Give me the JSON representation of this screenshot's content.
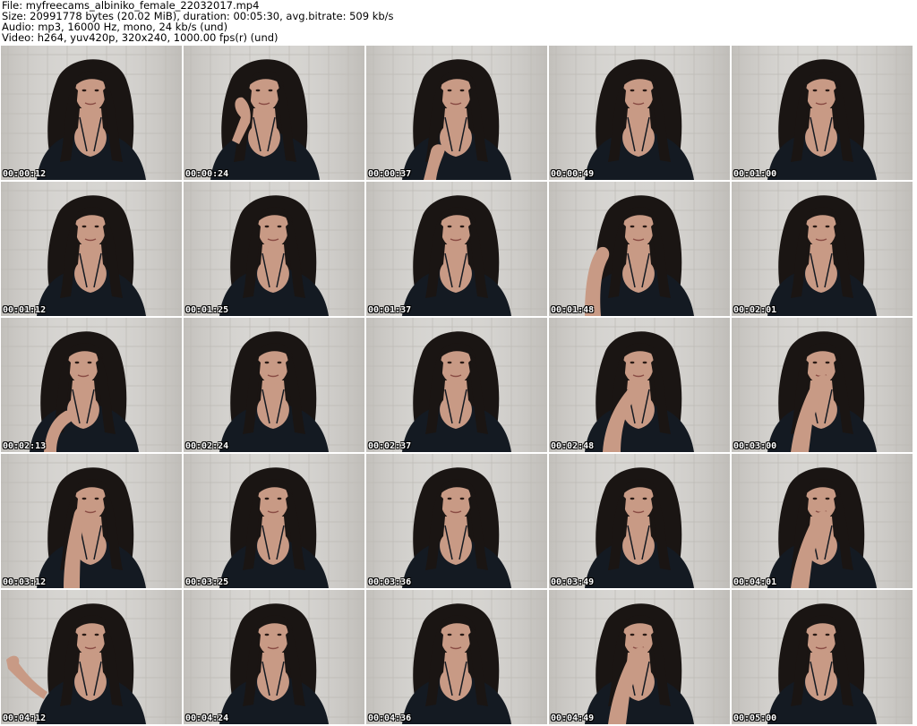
{
  "header": {
    "file": "File: myfreecams_albiniko_female_22032017.mp4",
    "size": "Size: 20991778 bytes (20.02 MiB), duration: 00:05:30, avg.bitrate: 509 kb/s",
    "audio": "Audio: mp3, 16000 Hz, mono, 24 kb/s (und)",
    "video": "Video: h264, yuv420p, 320x240, 1000.00 fps(r) (und)"
  },
  "colors": {
    "wall": "#cfcdc9",
    "tile_line": "#bdbab5",
    "hair": "#1a1513",
    "skin": "#c89a85",
    "top": "#141a22"
  },
  "thumbnails": [
    {
      "time": "00:00:12",
      "pose": "neutral"
    },
    {
      "time": "00:00:24",
      "pose": "hand-neck"
    },
    {
      "time": "00:00:37",
      "pose": "hand-low"
    },
    {
      "time": "00:00:49",
      "pose": "neutral"
    },
    {
      "time": "00:01:00",
      "pose": "neutral"
    },
    {
      "time": "00:01:12",
      "pose": "neutral"
    },
    {
      "time": "00:01:25",
      "pose": "neutral"
    },
    {
      "time": "00:01:37",
      "pose": "neutral"
    },
    {
      "time": "00:01:48",
      "pose": "hand-hair"
    },
    {
      "time": "00:02:01",
      "pose": "neutral"
    },
    {
      "time": "00:02:13",
      "pose": "hand-chest"
    },
    {
      "time": "00:02:24",
      "pose": "neutral"
    },
    {
      "time": "00:02:37",
      "pose": "neutral"
    },
    {
      "time": "00:02:48",
      "pose": "hand-chin"
    },
    {
      "time": "00:03:00",
      "pose": "hand-mouth"
    },
    {
      "time": "00:03:12",
      "pose": "hand-cheek"
    },
    {
      "time": "00:03:25",
      "pose": "neutral"
    },
    {
      "time": "00:03:36",
      "pose": "neutral"
    },
    {
      "time": "00:03:49",
      "pose": "neutral"
    },
    {
      "time": "00:04:01",
      "pose": "hand-mouth"
    },
    {
      "time": "00:04:12",
      "pose": "hand-hair-side"
    },
    {
      "time": "00:04:24",
      "pose": "neutral"
    },
    {
      "time": "00:04:36",
      "pose": "neutral"
    },
    {
      "time": "00:04:49",
      "pose": "hand-mouth"
    },
    {
      "time": "00:05:00",
      "pose": "neutral"
    }
  ]
}
